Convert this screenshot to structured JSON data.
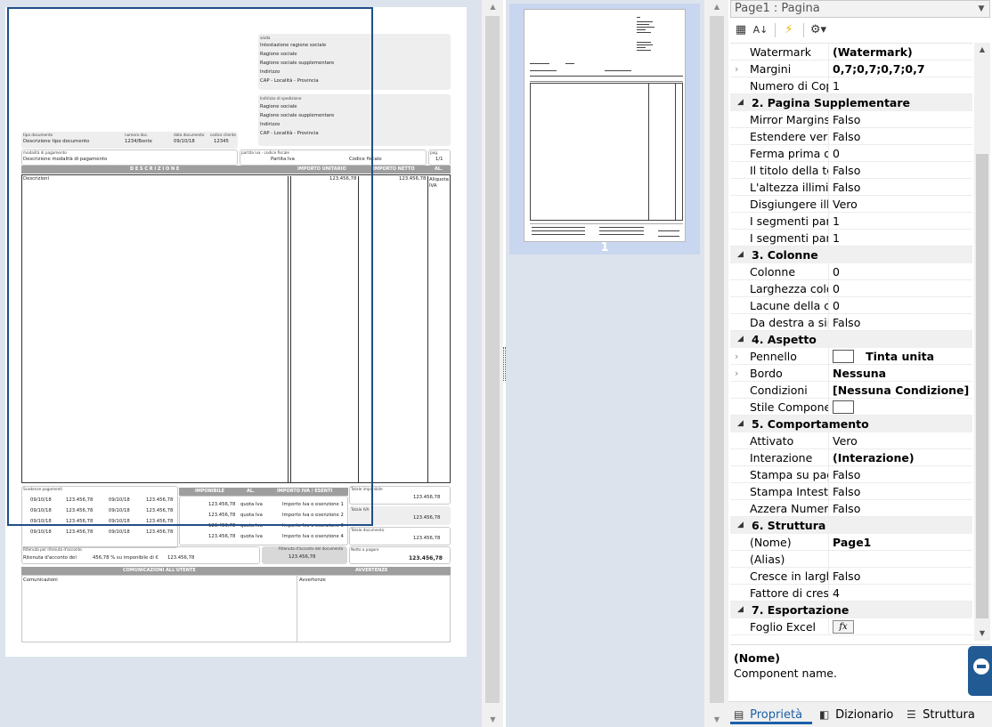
{
  "doc": {
    "recipient_label": "a/alla",
    "recipient_lines": [
      "Intestazione ragione sociale",
      "Ragione sociale",
      "Ragione sociale supplementare",
      "Indirizzo",
      "CAP - Località - Provincia"
    ],
    "payment_label": "Indirizzo di spedizione",
    "payment_lines": [
      "Ragione sociale",
      "Ragione sociale supplementare",
      "Indirizzo",
      "CAP - Località - Provincia"
    ],
    "doctype_labels": [
      "tipo documento",
      "numero doc.",
      "data documento",
      "codice cliente"
    ],
    "doctype_values": [
      "Descrizione tipo documento",
      "1234/Bonte",
      "09/10/18",
      "12345"
    ],
    "payment_mode_label": "modalità di pagamento",
    "payment_mode_value": "Descrizione modalità di pagamento",
    "vat_label": "partita iva - codice fiscale",
    "vat_value": "Partita Iva",
    "cf_value": "Codice fiscale",
    "page_label": "pag.",
    "page_value": "1/1",
    "table_headers": [
      "D E S C R I Z I O N E",
      "IMPORTO UNITARIO",
      "IMPORTO NETTO",
      "AL."
    ],
    "row_desc": "Descrizioni",
    "row_unit": "123.456,78",
    "row_net": "123.456,78",
    "row_al": "Aliquota IVA",
    "deadlines_label": "Scadenze pagamenti",
    "deadlines": [
      [
        "09/10/18",
        "123.456,78",
        "09/10/18",
        "123.456,78"
      ],
      [
        "09/10/18",
        "123.456,78",
        "09/10/18",
        "123.456,78"
      ],
      [
        "09/10/18",
        "123.456,78",
        "09/10/18",
        "123.456,78"
      ],
      [
        "09/10/18",
        "123.456,78",
        "09/10/18",
        "123.456,78"
      ]
    ],
    "vat_headers": [
      "IMPONIBILE",
      "AL.",
      "IMPORTO IVA / ESENTI"
    ],
    "vat_rows": [
      [
        "123.456,78",
        "quota Iva",
        "Importo Iva o esenzione 1"
      ],
      [
        "123.456,78",
        "quota Iva",
        "Importo Iva o esenzione 2"
      ],
      [
        "123.456,78",
        "quota Iva",
        "Importo Iva o esenzione 3"
      ],
      [
        "123.456,78",
        "quota Iva",
        "Importo Iva o esenzione 4"
      ]
    ],
    "totals": [
      {
        "label": "Totale imponibile",
        "value": "123.456,78"
      },
      {
        "label": "Totale IVA",
        "value": "123.456,78"
      },
      {
        "label": "Totale documento",
        "value": "123.456,78"
      }
    ],
    "withholding_label": "Ritenuta per ritenuta d'acconto",
    "withholding_text": "Ritenuta d'acconto del",
    "withholding_pct": "456,78 % su imponibile di €",
    "withholding_amount": "123.456,78",
    "discount_label": "Ritenuta d'acconto del documento",
    "discount_value": "123.456,78",
    "net_label": "Netto a pagare",
    "net_value": "123.456,78",
    "bottom_headers": [
      "COMUNICAZIONI ALL'UTENTE",
      "AVVERTENZE"
    ],
    "bottom_values": [
      "Comunicazioni",
      "Avvertenze"
    ]
  },
  "thumbnail": {
    "page_number": "1"
  },
  "props": {
    "combo": "Page1 : Pagina",
    "rows": [
      {
        "type": "row",
        "name": "Watermark",
        "value": "(Watermark)",
        "bold": true
      },
      {
        "type": "row",
        "exp": "›",
        "name": "Margini",
        "value": "0,7;0,7;0,7;0,7",
        "bold": true
      },
      {
        "type": "row",
        "name": "Numero di Copie",
        "value": "1"
      },
      {
        "type": "cat",
        "name": "2. Pagina Supplementare"
      },
      {
        "type": "row",
        "name": "Mirror Margins",
        "value": "Falso"
      },
      {
        "type": "row",
        "name": "Estendere verso",
        "value": "Falso"
      },
      {
        "type": "row",
        "name": "Ferma prima del",
        "value": "0"
      },
      {
        "type": "row",
        "name": "Il titolo della testata",
        "value": "Falso"
      },
      {
        "type": "row",
        "name": "L'altezza illimitata",
        "value": "Falso"
      },
      {
        "type": "row",
        "name": "Disgiungere illimitato",
        "value": "Vero"
      },
      {
        "type": "row",
        "name": "I segmenti par larghezza",
        "value": "1"
      },
      {
        "type": "row",
        "name": "I segmenti par larghezza",
        "value": "1"
      },
      {
        "type": "cat",
        "name": "3. Colonne"
      },
      {
        "type": "row",
        "name": "Colonne",
        "value": "0"
      },
      {
        "type": "row",
        "name": "Larghezza colonna",
        "value": "0"
      },
      {
        "type": "row",
        "name": "Lacune della colonna",
        "value": "0"
      },
      {
        "type": "row",
        "name": "Da destra a sinistra",
        "value": "Falso"
      },
      {
        "type": "cat",
        "name": "4. Aspetto"
      },
      {
        "type": "row",
        "exp": "›",
        "name": "Pennello",
        "value": "Tinta unita",
        "bold": true,
        "swatch": true
      },
      {
        "type": "row",
        "exp": "›",
        "name": "Bordo",
        "value": "Nessuna",
        "bold": true
      },
      {
        "type": "row",
        "name": "Condizioni",
        "value": "[Nessuna Condizione]",
        "bold": true
      },
      {
        "type": "row",
        "name": "Stile Componente",
        "value": "",
        "swatch": true
      },
      {
        "type": "cat",
        "name": "5. Comportamento"
      },
      {
        "type": "row",
        "name": "Attivato",
        "value": "Vero"
      },
      {
        "type": "row",
        "name": "Interazione",
        "value": "(Interazione)",
        "bold": true
      },
      {
        "type": "row",
        "name": "Stampa su pagine",
        "value": "Falso"
      },
      {
        "type": "row",
        "name": "Stampa Intestazione",
        "value": "Falso"
      },
      {
        "type": "row",
        "name": "Azzera Numero",
        "value": "Falso"
      },
      {
        "type": "cat",
        "name": "6. Struttura"
      },
      {
        "type": "row",
        "name": "(Nome)",
        "value": "Page1",
        "bold": true
      },
      {
        "type": "row",
        "name": "(Alias)",
        "value": ""
      },
      {
        "type": "row",
        "name": "Cresce in larghezza",
        "value": "Falso"
      },
      {
        "type": "row",
        "name": "Fattore di crescita",
        "value": "4"
      },
      {
        "type": "cat",
        "name": "7. Esportazione"
      },
      {
        "type": "row",
        "name": "Foglio Excel",
        "value": "",
        "fx": true
      }
    ],
    "desc_title": "(Nome)",
    "desc_text": "Component name.",
    "tabs": [
      {
        "label": "Proprietà",
        "icon": "properties-icon",
        "glyph": "▤"
      },
      {
        "label": "Dizionario",
        "icon": "dictionary-icon",
        "glyph": "◧"
      },
      {
        "label": "Struttura",
        "icon": "structure-icon",
        "glyph": "☰"
      }
    ]
  }
}
